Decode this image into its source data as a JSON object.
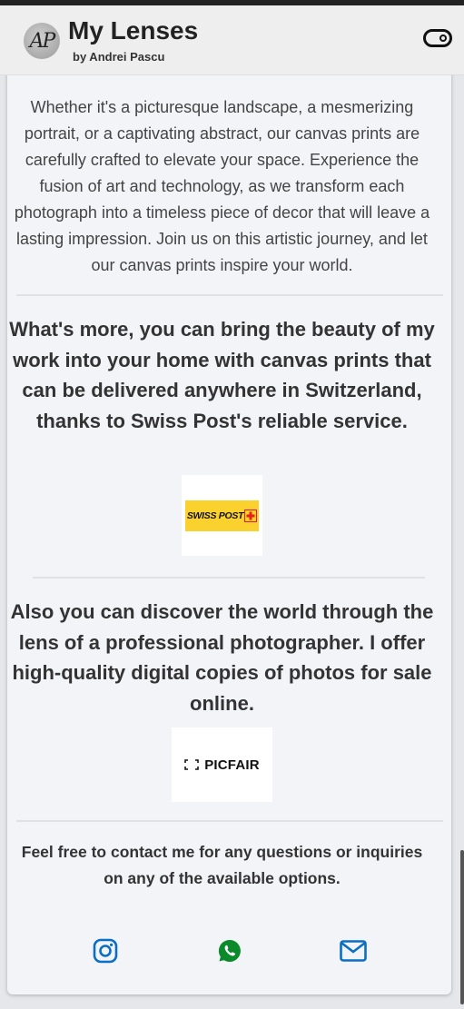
{
  "header": {
    "avatar_initials": "AP",
    "title": "My Lenses",
    "subtitle": "by Andrei Pascu"
  },
  "intro": {
    "paragraph": "Whether it's a picturesque landscape, a mesmerizing portrait, or a captivating abstract, our canvas prints are carefully crafted to elevate your space. Experience the fusion of art and technology, as we transform each photograph into a timeless piece of decor that will leave a lasting impression. Join us on this artistic journey, and let our canvas prints inspire your world."
  },
  "canvas_section": {
    "heading": "What's more, you can bring the beauty of my work into your home with canvas prints that can be delivered anywhere in Switzerland, thanks to Swiss Post's reliable service.",
    "logo_text": "SWISS POST"
  },
  "digital_section": {
    "heading": "Also you can discover the world through the lens of a professional photographer. I offer high-quality digital copies of photos for sale online.",
    "logo_text": "PICFAIR"
  },
  "contact": {
    "text": "Feel free to contact me for any questions or inquiries on any of the available options."
  },
  "social": [
    {
      "icon": "instagram-icon",
      "color": "#0a6fc2"
    },
    {
      "icon": "whatsapp-icon",
      "color": "#0a8a2a"
    },
    {
      "icon": "mail-icon",
      "color": "#0a6fc2"
    }
  ],
  "colors": {
    "accent_blue": "#0a6fc2",
    "whatsapp_green": "#0a8a2a",
    "swisspost_yellow": "#fbd12e",
    "swisspost_red": "#e2231a"
  }
}
